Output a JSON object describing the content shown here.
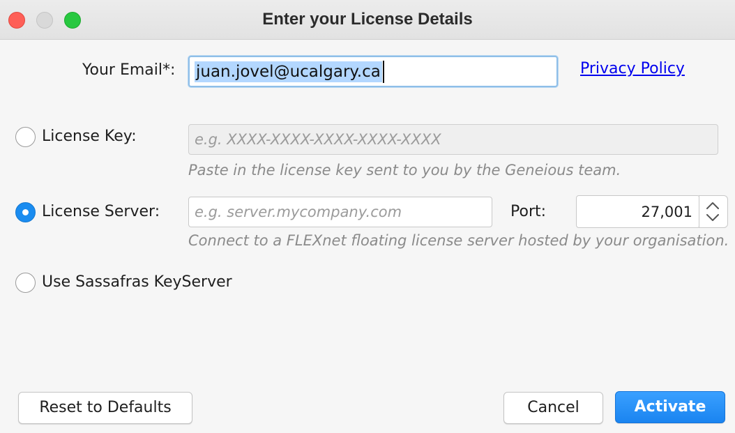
{
  "window": {
    "title": "Enter your License Details",
    "controls": [
      "close",
      "minimize",
      "maximize"
    ]
  },
  "email": {
    "label": "Your Email*:",
    "value": "juan.jovel@ucalgary.ca",
    "selected": true,
    "privacy_link": "Privacy Policy"
  },
  "license_key": {
    "label": "License Key:",
    "checked": false,
    "placeholder": "e.g. XXXX-XXXX-XXXX-XXXX-XXXX",
    "hint": "Paste in the license key sent to you by the Geneious team.",
    "disabled": true
  },
  "license_server": {
    "label": "License Server:",
    "checked": true,
    "placeholder": "e.g. server.mycompany.com",
    "port_label": "Port:",
    "port_value": "27,001",
    "hint": "Connect to a FLEXnet floating license server hosted by your organisation."
  },
  "sassafras": {
    "label": "Use Sassafras KeyServer",
    "checked": false
  },
  "buttons": {
    "reset": "Reset to Defaults",
    "cancel": "Cancel",
    "activate": "Activate"
  },
  "colors": {
    "accent": "#1a8cf0",
    "link": "#0000ee",
    "selection": "#b3d7ff"
  }
}
